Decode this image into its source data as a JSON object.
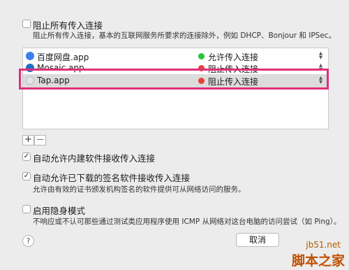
{
  "block_all": {
    "checked": false,
    "label": "阻止所有传入连接",
    "description": "阻止所有传入连接，基本的互联网服务所要求的连接除外，例如 DHCP、Bonjour 和 IPSec。"
  },
  "apps": [
    {
      "name": "百度网盘.app",
      "status": "允许传入连接",
      "status_color": "#27c43a",
      "icon": "baidu-icon",
      "icon_color": "#3a7ff0"
    },
    {
      "name": "Mosaic.app",
      "status": "阻止传入连接",
      "status_color": "#e8403a",
      "icon": "mosaic-icon",
      "icon_color": "#1f6fc4"
    },
    {
      "name": "Tap.app",
      "status": "阻止传入连接",
      "status_color": "#e8403a",
      "icon": "tap-icon",
      "icon_color": "#e6e6e6"
    }
  ],
  "list_buttons": {
    "add": "+",
    "remove": "—"
  },
  "allow_builtin": {
    "checked": true,
    "label": "自动允许内建软件接收传入连接"
  },
  "allow_signed": {
    "checked": true,
    "label": "自动允许已下载的签名软件接收传入连接",
    "description": "允许由有效的证书颁发机构签名的软件提供可从网络访问的服务。"
  },
  "stealth": {
    "checked": false,
    "label": "启用隐身模式",
    "description": "不响应或不认可那些通过测试类应用程序使用 ICMP 从网络对这台电脑的访问尝试（如 Ping）。"
  },
  "help_label": "?",
  "cancel_label": "取消",
  "watermark": {
    "site": "jb51.net",
    "name": "脚本之家"
  },
  "accent": {
    "highlight": "#e0307a"
  }
}
